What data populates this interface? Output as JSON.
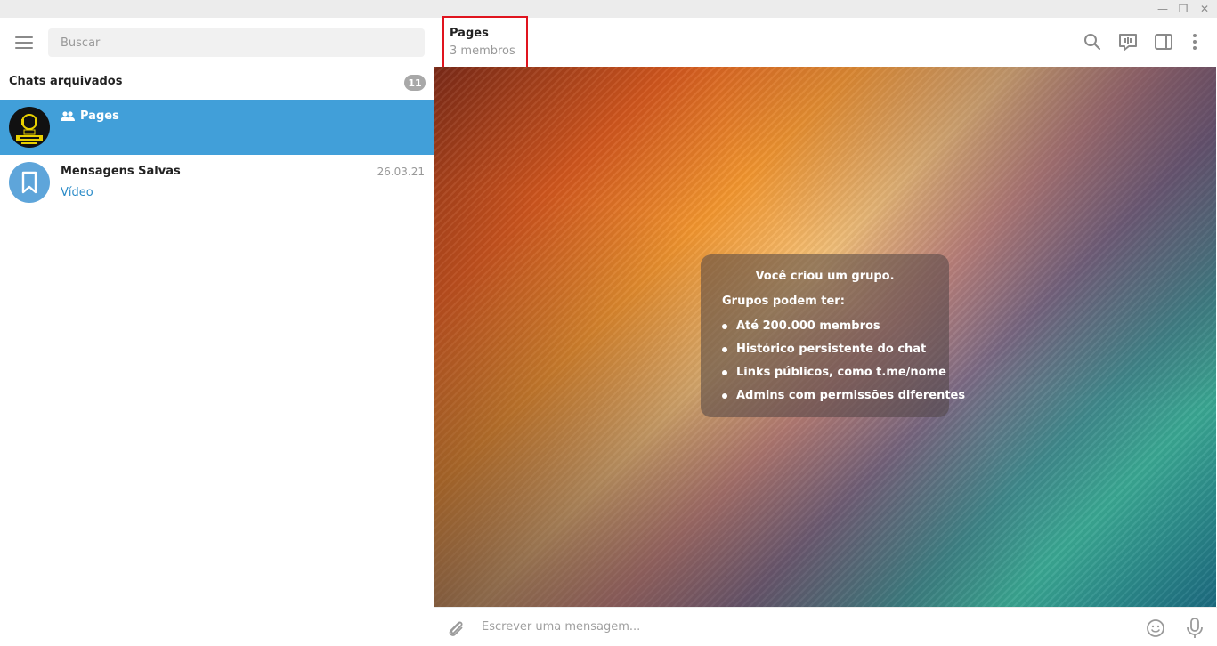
{
  "window": {
    "minimize": "—",
    "restore": "❐",
    "close": "✕"
  },
  "sidebar": {
    "search_placeholder": "Buscar",
    "section_title": "Chats arquivados",
    "section_count": "11",
    "chats": [
      {
        "name": "Pages",
        "date": "",
        "preview": "",
        "active": true
      },
      {
        "name": "Mensagens Salvas",
        "date": "26.03.21",
        "preview": "Vídeo",
        "active": false
      }
    ]
  },
  "header": {
    "title": "Pages",
    "subtitle": "3 membros"
  },
  "notice": {
    "title": "Você criou um grupo.",
    "subtitle": "Grupos podem ter:",
    "items": [
      "Até 200.000 membros",
      "Histórico persistente do chat",
      "Links públicos, como t.me/nome",
      "Admins com permissões diferentes"
    ]
  },
  "composer": {
    "placeholder": "Escrever uma mensagem..."
  },
  "colors": {
    "accent": "#419fd9",
    "highlight": "#e0141e"
  }
}
